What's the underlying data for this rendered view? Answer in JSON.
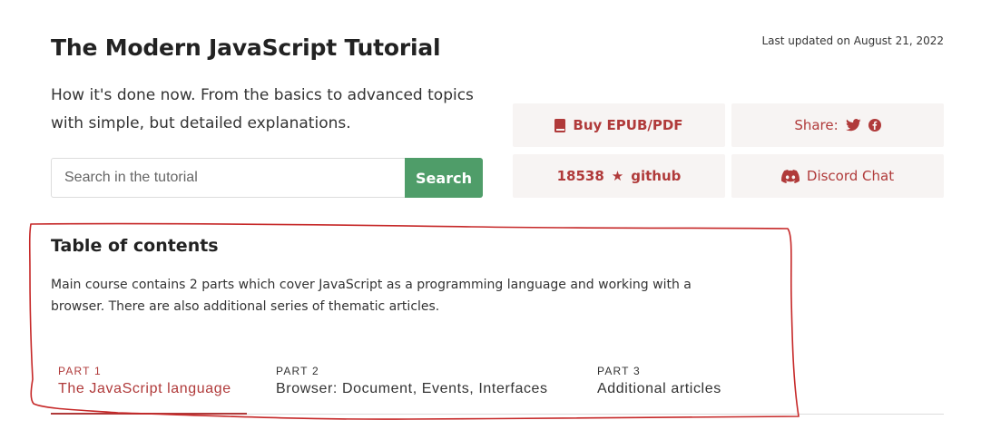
{
  "header": {
    "title": "The Modern JavaScript Tutorial",
    "last_updated": "Last updated on August 21, 2022",
    "subtitle": "How it's done now. From the basics to advanced topics with simple, but detailed explanations."
  },
  "search": {
    "placeholder": "Search in the tutorial",
    "value": "",
    "button_label": "Search"
  },
  "actions": {
    "epub_label": "Buy EPUB/PDF",
    "share_label": "Share:",
    "github_stars": "18538",
    "github_star_glyph": "★",
    "github_label": "github",
    "discord_label": "Discord Chat",
    "icons": [
      "book-icon",
      "twitter-icon",
      "facebook-icon",
      "discord-icon"
    ]
  },
  "toc": {
    "heading": "Table of contents",
    "description": "Main course contains 2 parts which cover JavaScript as a programming language and working with a browser. There are also additional series of thematic articles.",
    "parts": [
      {
        "number": "PART 1",
        "name": "The JavaScript language",
        "active": true
      },
      {
        "number": "PART 2",
        "name": "Browser: Document, Events, Interfaces",
        "active": false
      },
      {
        "number": "PART 3",
        "name": "Additional articles",
        "active": false
      }
    ]
  },
  "colors": {
    "accent": "#b03a3a",
    "search_button": "#4f9d69",
    "tile_background": "#f7f4f3",
    "annotation_stroke": "#c62828"
  }
}
